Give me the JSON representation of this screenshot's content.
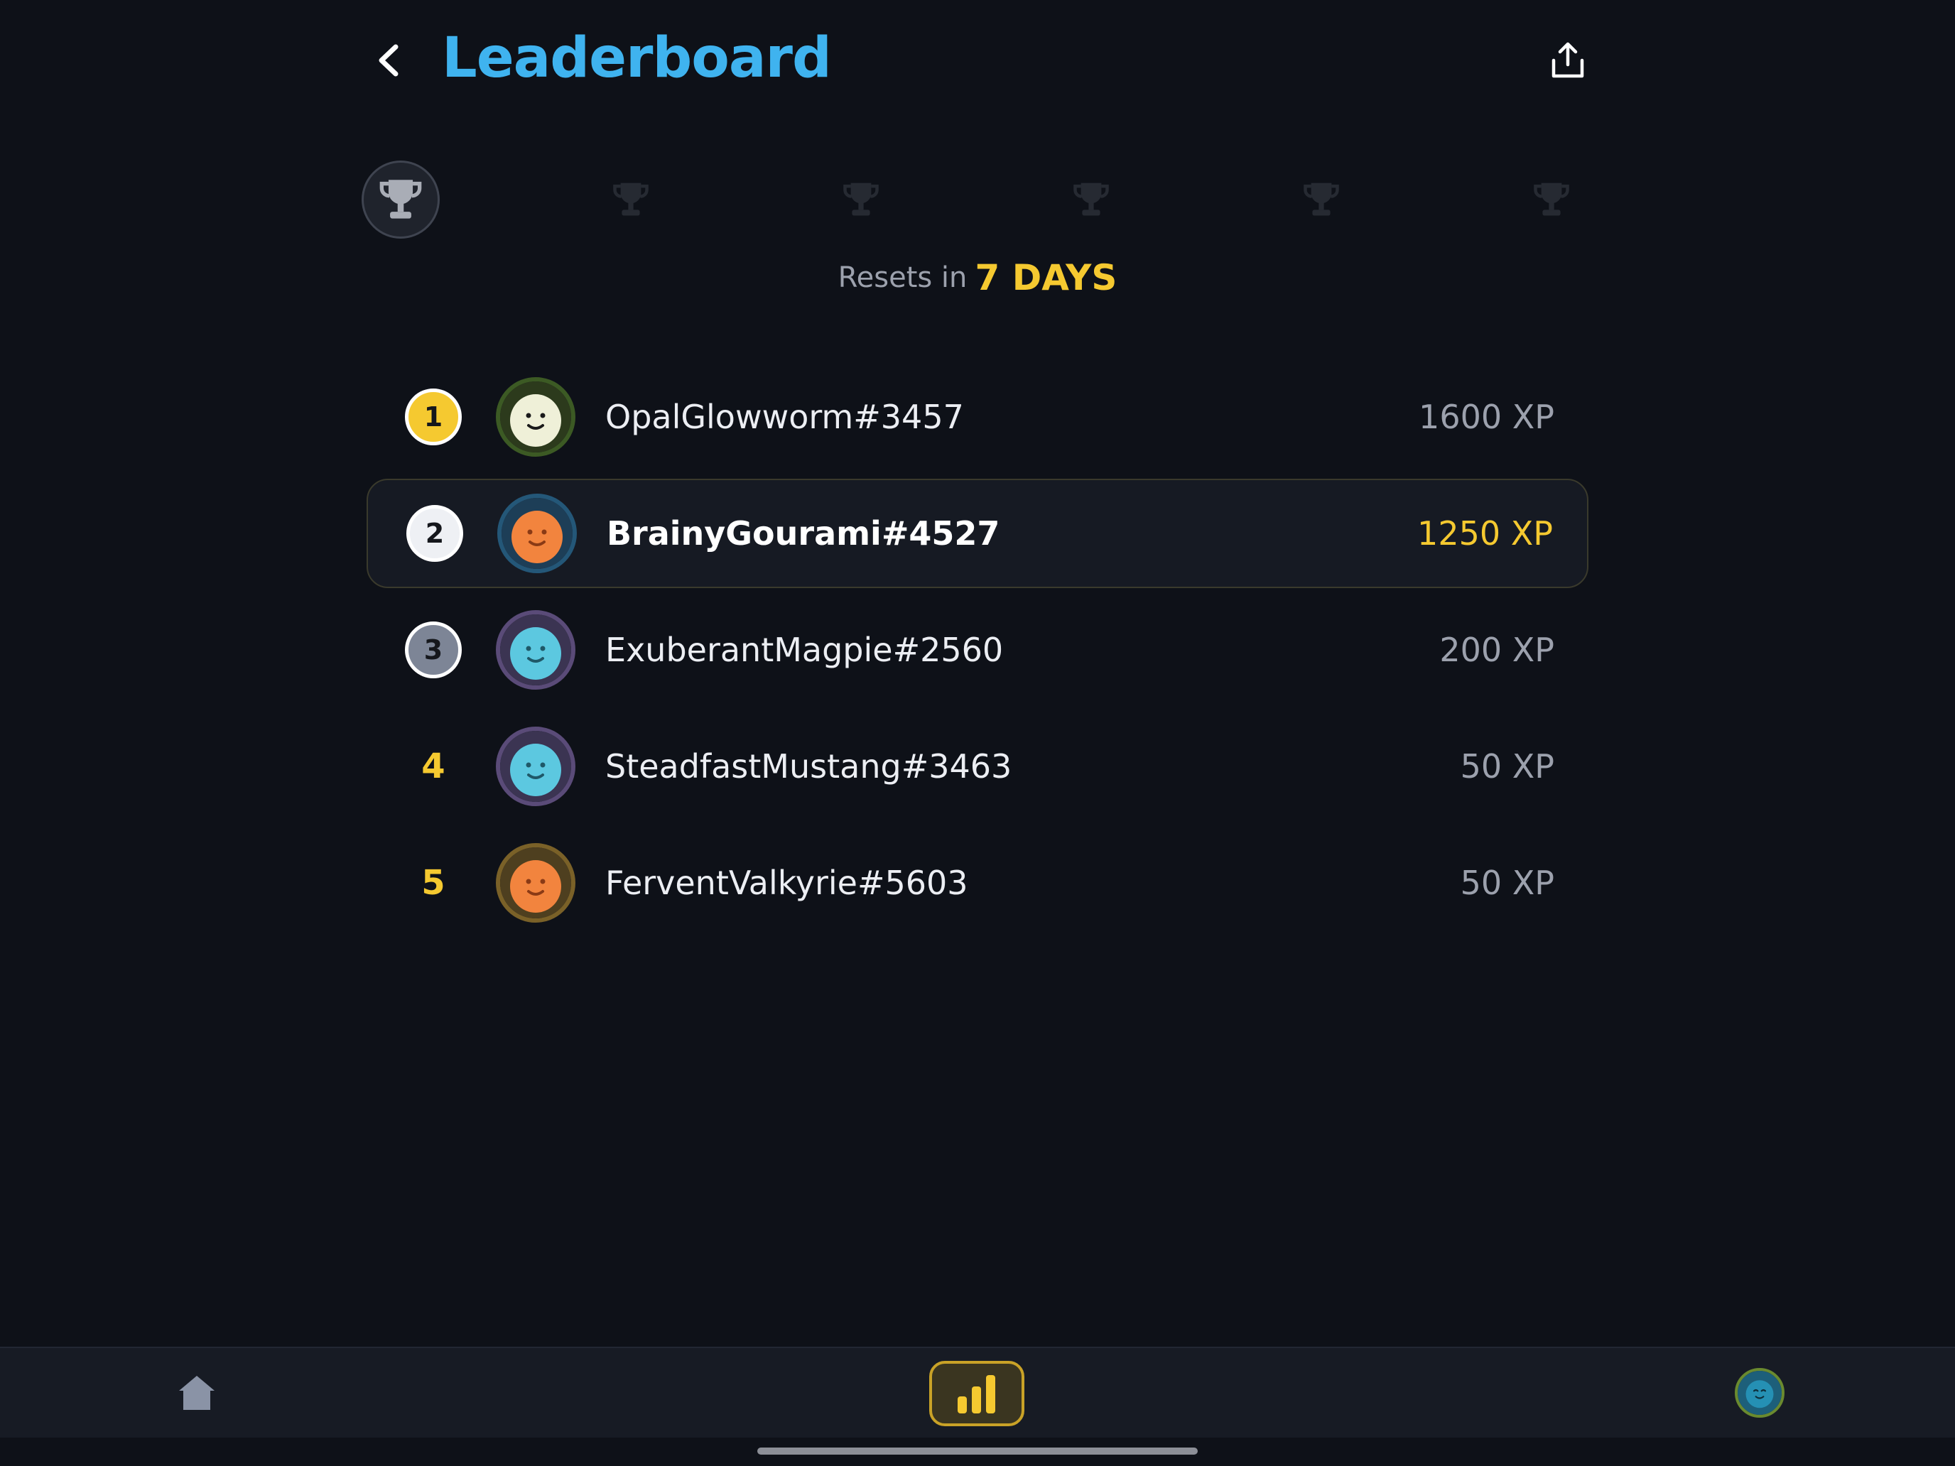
{
  "header": {
    "title": "Leaderboard",
    "back_icon": "chevron-left-icon",
    "share_icon": "share-icon"
  },
  "leagues": {
    "icon": "trophy-icon",
    "count": 6,
    "active_index": 0
  },
  "reset": {
    "prefix": "Resets in",
    "value": "7 DAYS"
  },
  "ranking": [
    {
      "rank": "1",
      "badge": "gold",
      "name": "OpalGlowworm#3457",
      "xp": "1600 XP",
      "current": false,
      "avatar": {
        "ring": "#3c5a24",
        "bg": "#2c3a1c",
        "face": "#eff0d8",
        "feature": "#1a1a1a"
      }
    },
    {
      "rank": "2",
      "badge": "silver",
      "name": "BrainyGourami#4527",
      "xp": "1250 XP",
      "current": true,
      "avatar": {
        "ring": "#245778",
        "bg": "#1d3e57",
        "face": "#f2843e",
        "feature": "#8a3a15"
      }
    },
    {
      "rank": "3",
      "badge": "bronze",
      "name": "ExuberantMagpie#2560",
      "xp": "200 XP",
      "current": false,
      "avatar": {
        "ring": "#5a4b78",
        "bg": "#3b3452",
        "face": "#5cc8e0",
        "feature": "#1f5868"
      }
    },
    {
      "rank": "4",
      "badge": "none",
      "name": "SteadfastMustang#3463",
      "xp": "50 XP",
      "current": false,
      "avatar": {
        "ring": "#5a4b78",
        "bg": "#3b3452",
        "face": "#5cc8e0",
        "feature": "#1f5868"
      }
    },
    {
      "rank": "5",
      "badge": "none",
      "name": "FerventValkyrie#5603",
      "xp": "50 XP",
      "current": false,
      "avatar": {
        "ring": "#7a6128",
        "bg": "#4e3f1f",
        "face": "#f2843e",
        "feature": "#8a3a15"
      }
    }
  ],
  "bottom_nav": {
    "items": [
      {
        "icon": "home-icon",
        "active": false
      },
      {
        "icon": "bar-chart-icon",
        "active": true
      },
      {
        "icon": "profile-avatar",
        "active": false
      }
    ]
  },
  "colors": {
    "accent_blue": "#3fb3ef",
    "accent_gold": "#f5c930",
    "background": "#0e1118",
    "muted_text": "#9ca1ad"
  }
}
